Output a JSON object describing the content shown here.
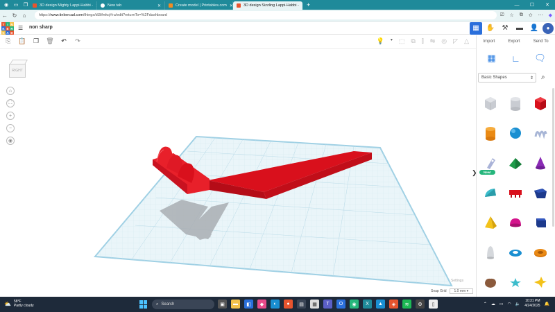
{
  "browser": {
    "tabs": [
      {
        "title": "3D design Mighty Lappi-Habbi -",
        "favicon_color": "#e8542e",
        "active": false
      },
      {
        "title": "New tab",
        "favicon_color": "#ffffff",
        "active": false
      },
      {
        "title": "Create model | Printables.com",
        "favicon_color": "#f38b21",
        "active": false
      },
      {
        "title": "3D design Sizzling Lappi-Habbi -",
        "favicon_color": "#e8542e",
        "active": true
      }
    ],
    "new_tab_symbol": "+",
    "url_prefix": "https://",
    "url_host": "www.tinkercad.com",
    "url_path": "/things/di3ifmkqYru/edit?returnTo=%2Fdashboard"
  },
  "app": {
    "logo_letters": [
      "T",
      "I",
      "N",
      "K",
      "E",
      "R",
      "C",
      "A",
      "D"
    ],
    "logo_colors": [
      "#e8542e",
      "#26b67c",
      "#f3c24b",
      "#2a6fdb",
      "#e8542e",
      "#26b67c",
      "#f3c24b",
      "#2a6fdb",
      "#e8542e"
    ],
    "design_title": "non sharp"
  },
  "panel": {
    "import_label": "Import",
    "export_label": "Export",
    "sendto_label": "Send To",
    "category": "Basic Shapes",
    "new_badge": "New!"
  },
  "workspace": {
    "viewcube_label": "RIGHT",
    "settings_label": "Settings",
    "snap_label": "Snap Grid",
    "snap_value": "1.0 mm"
  },
  "taskbar": {
    "temperature": "58°F",
    "weather_desc": "Partly cloudy",
    "search_placeholder": "Search",
    "time": "10:31 PM",
    "date": "4/24/2025"
  },
  "accent_color": "#2a6fdb",
  "model_color": "#e8202a"
}
